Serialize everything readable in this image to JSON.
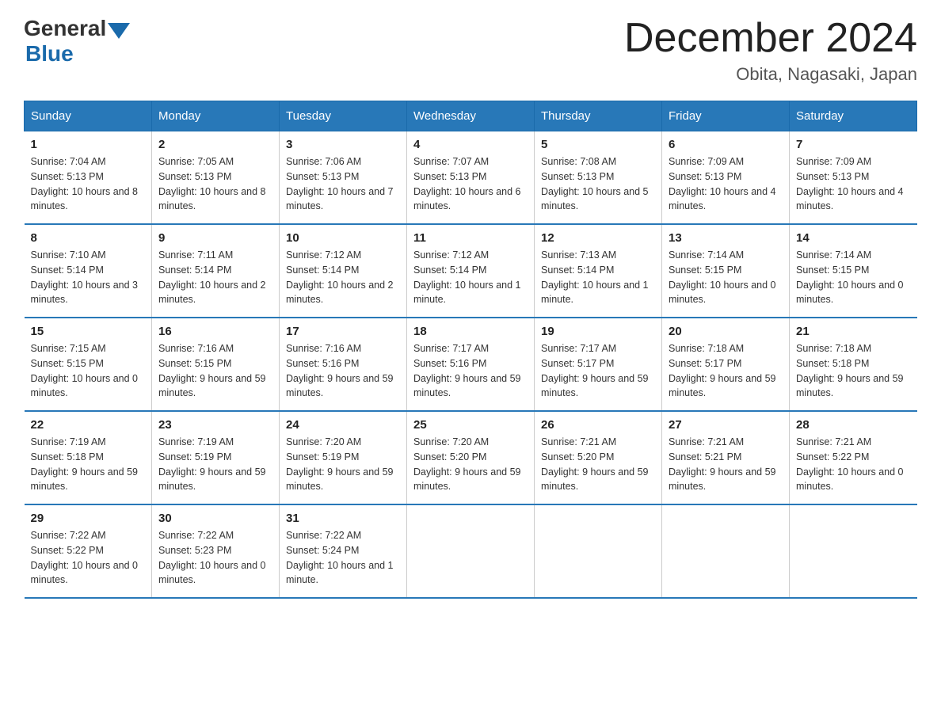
{
  "header": {
    "logo_general": "General",
    "logo_blue": "Blue",
    "month_title": "December 2024",
    "location": "Obita, Nagasaki, Japan"
  },
  "days_of_week": [
    "Sunday",
    "Monday",
    "Tuesday",
    "Wednesday",
    "Thursday",
    "Friday",
    "Saturday"
  ],
  "weeks": [
    [
      {
        "day": "1",
        "sunrise": "7:04 AM",
        "sunset": "5:13 PM",
        "daylight": "10 hours and 8 minutes."
      },
      {
        "day": "2",
        "sunrise": "7:05 AM",
        "sunset": "5:13 PM",
        "daylight": "10 hours and 8 minutes."
      },
      {
        "day": "3",
        "sunrise": "7:06 AM",
        "sunset": "5:13 PM",
        "daylight": "10 hours and 7 minutes."
      },
      {
        "day": "4",
        "sunrise": "7:07 AM",
        "sunset": "5:13 PM",
        "daylight": "10 hours and 6 minutes."
      },
      {
        "day": "5",
        "sunrise": "7:08 AM",
        "sunset": "5:13 PM",
        "daylight": "10 hours and 5 minutes."
      },
      {
        "day": "6",
        "sunrise": "7:09 AM",
        "sunset": "5:13 PM",
        "daylight": "10 hours and 4 minutes."
      },
      {
        "day": "7",
        "sunrise": "7:09 AM",
        "sunset": "5:13 PM",
        "daylight": "10 hours and 4 minutes."
      }
    ],
    [
      {
        "day": "8",
        "sunrise": "7:10 AM",
        "sunset": "5:14 PM",
        "daylight": "10 hours and 3 minutes."
      },
      {
        "day": "9",
        "sunrise": "7:11 AM",
        "sunset": "5:14 PM",
        "daylight": "10 hours and 2 minutes."
      },
      {
        "day": "10",
        "sunrise": "7:12 AM",
        "sunset": "5:14 PM",
        "daylight": "10 hours and 2 minutes."
      },
      {
        "day": "11",
        "sunrise": "7:12 AM",
        "sunset": "5:14 PM",
        "daylight": "10 hours and 1 minute."
      },
      {
        "day": "12",
        "sunrise": "7:13 AM",
        "sunset": "5:14 PM",
        "daylight": "10 hours and 1 minute."
      },
      {
        "day": "13",
        "sunrise": "7:14 AM",
        "sunset": "5:15 PM",
        "daylight": "10 hours and 0 minutes."
      },
      {
        "day": "14",
        "sunrise": "7:14 AM",
        "sunset": "5:15 PM",
        "daylight": "10 hours and 0 minutes."
      }
    ],
    [
      {
        "day": "15",
        "sunrise": "7:15 AM",
        "sunset": "5:15 PM",
        "daylight": "10 hours and 0 minutes."
      },
      {
        "day": "16",
        "sunrise": "7:16 AM",
        "sunset": "5:15 PM",
        "daylight": "9 hours and 59 minutes."
      },
      {
        "day": "17",
        "sunrise": "7:16 AM",
        "sunset": "5:16 PM",
        "daylight": "9 hours and 59 minutes."
      },
      {
        "day": "18",
        "sunrise": "7:17 AM",
        "sunset": "5:16 PM",
        "daylight": "9 hours and 59 minutes."
      },
      {
        "day": "19",
        "sunrise": "7:17 AM",
        "sunset": "5:17 PM",
        "daylight": "9 hours and 59 minutes."
      },
      {
        "day": "20",
        "sunrise": "7:18 AM",
        "sunset": "5:17 PM",
        "daylight": "9 hours and 59 minutes."
      },
      {
        "day": "21",
        "sunrise": "7:18 AM",
        "sunset": "5:18 PM",
        "daylight": "9 hours and 59 minutes."
      }
    ],
    [
      {
        "day": "22",
        "sunrise": "7:19 AM",
        "sunset": "5:18 PM",
        "daylight": "9 hours and 59 minutes."
      },
      {
        "day": "23",
        "sunrise": "7:19 AM",
        "sunset": "5:19 PM",
        "daylight": "9 hours and 59 minutes."
      },
      {
        "day": "24",
        "sunrise": "7:20 AM",
        "sunset": "5:19 PM",
        "daylight": "9 hours and 59 minutes."
      },
      {
        "day": "25",
        "sunrise": "7:20 AM",
        "sunset": "5:20 PM",
        "daylight": "9 hours and 59 minutes."
      },
      {
        "day": "26",
        "sunrise": "7:21 AM",
        "sunset": "5:20 PM",
        "daylight": "9 hours and 59 minutes."
      },
      {
        "day": "27",
        "sunrise": "7:21 AM",
        "sunset": "5:21 PM",
        "daylight": "9 hours and 59 minutes."
      },
      {
        "day": "28",
        "sunrise": "7:21 AM",
        "sunset": "5:22 PM",
        "daylight": "10 hours and 0 minutes."
      }
    ],
    [
      {
        "day": "29",
        "sunrise": "7:22 AM",
        "sunset": "5:22 PM",
        "daylight": "10 hours and 0 minutes."
      },
      {
        "day": "30",
        "sunrise": "7:22 AM",
        "sunset": "5:23 PM",
        "daylight": "10 hours and 0 minutes."
      },
      {
        "day": "31",
        "sunrise": "7:22 AM",
        "sunset": "5:24 PM",
        "daylight": "10 hours and 1 minute."
      },
      null,
      null,
      null,
      null
    ]
  ],
  "labels": {
    "sunrise": "Sunrise:",
    "sunset": "Sunset:",
    "daylight": "Daylight:"
  }
}
